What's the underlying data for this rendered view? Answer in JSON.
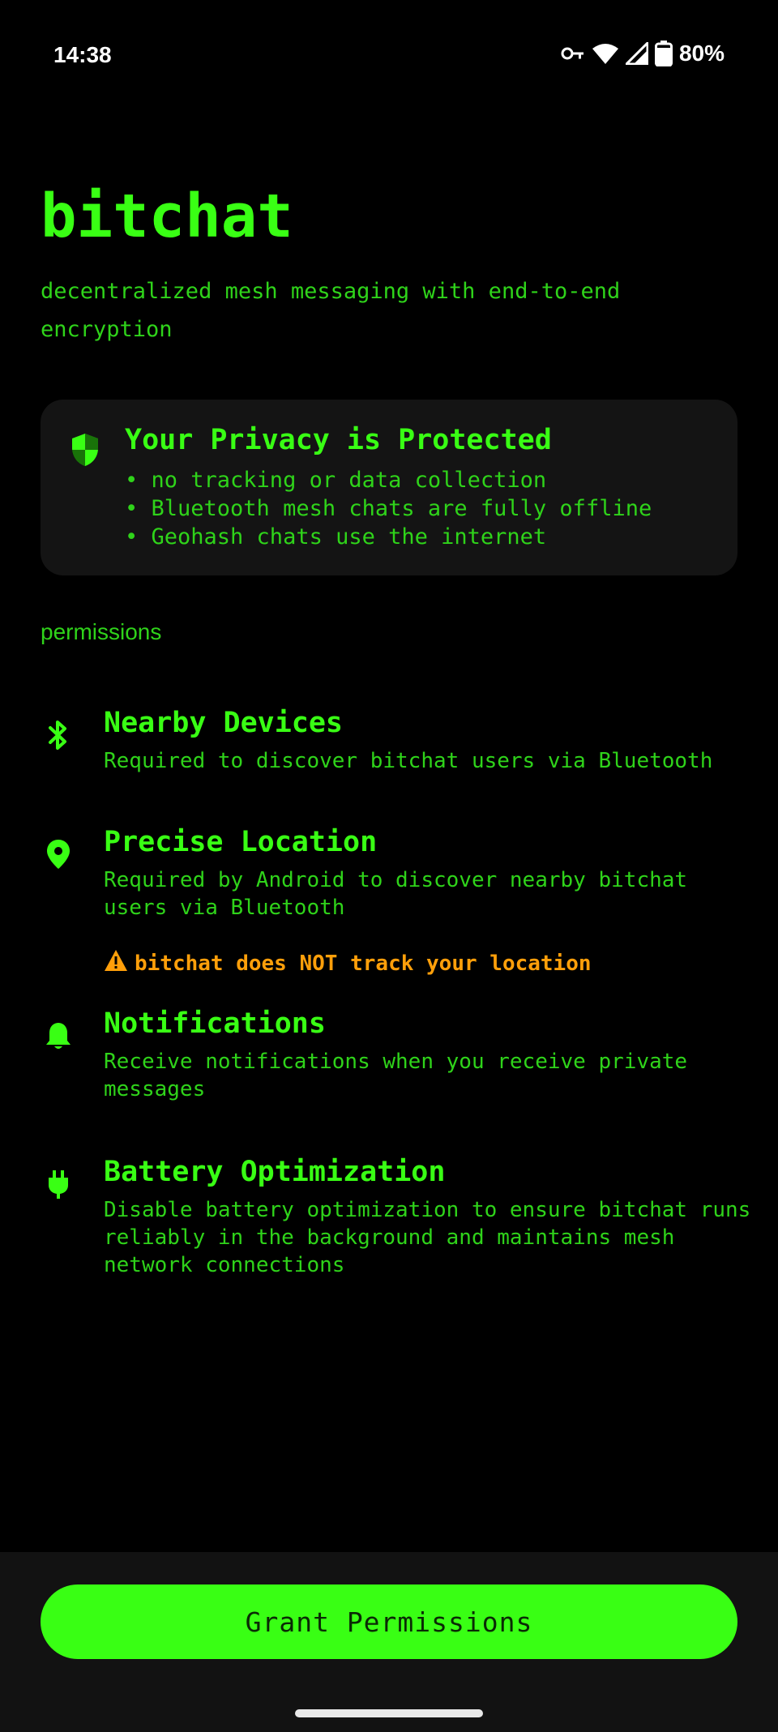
{
  "status_bar": {
    "time": "14:38",
    "battery": "80%",
    "icons": [
      "vpn-key-icon",
      "wifi-icon",
      "cell-signal-icon",
      "battery-icon"
    ]
  },
  "app": {
    "title": "bitchat",
    "tagline": "decentralized mesh messaging with end-to-end encryption"
  },
  "privacy_card": {
    "icon": "shield-icon",
    "title": "Your Privacy is Protected",
    "points": [
      "• no tracking or data collection",
      "• Bluetooth mesh chats are fully offline",
      "• Geohash chats use the internet"
    ]
  },
  "permissions": {
    "heading": "permissions",
    "items": [
      {
        "icon": "bluetooth-icon",
        "title": "Nearby Devices",
        "description": "Required to discover bitchat users via Bluetooth"
      },
      {
        "icon": "location-pin-icon",
        "title": "Precise Location",
        "description": "Required by Android to discover nearby bitchat users via Bluetooth",
        "warning": "bitchat does NOT track your location"
      },
      {
        "icon": "bell-icon",
        "title": "Notifications",
        "description": "Receive notifications when you receive private messages"
      },
      {
        "icon": "plug-icon",
        "title": "Battery Optimization",
        "description": "Disable battery optimization to ensure bitchat runs reliably in the background and maintains mesh network connections"
      }
    ]
  },
  "actions": {
    "grant_label": "Grant Permissions"
  },
  "colors": {
    "accent": "#39ff14",
    "text_secondary": "#2fd31a",
    "warning": "#ff9f0a",
    "card_background": "#141414",
    "background": "#000000"
  }
}
